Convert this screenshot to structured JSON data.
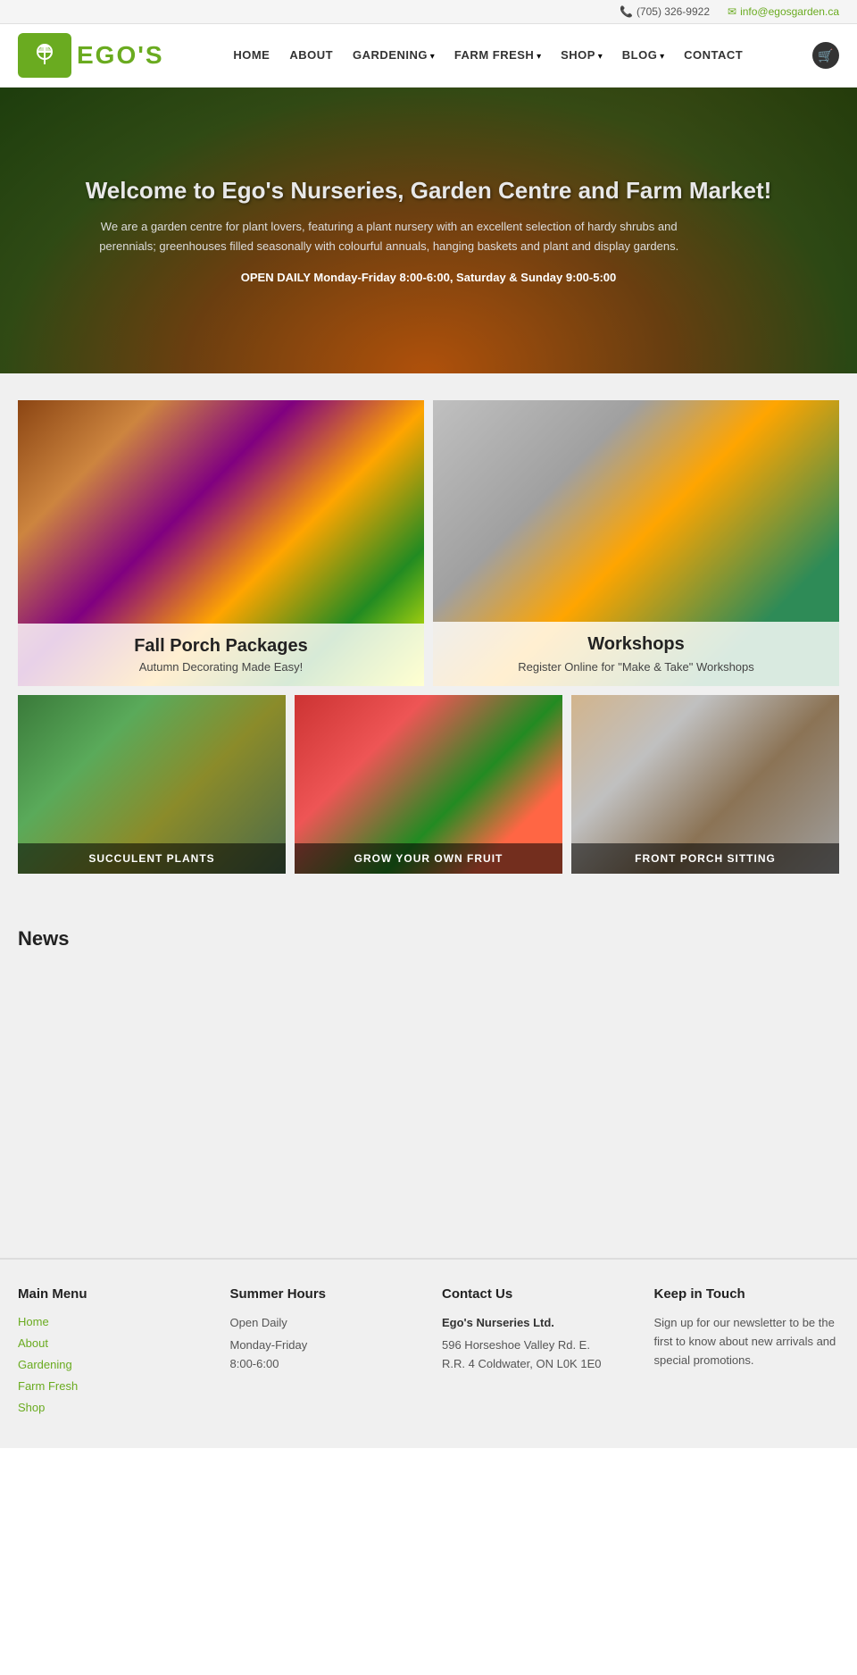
{
  "topbar": {
    "phone": "(705) 326-9922",
    "email": "info@egosgarden.ca",
    "phone_icon": "📞",
    "email_icon": "✉"
  },
  "nav": {
    "logo_text": "EGO'S",
    "links": [
      {
        "label": "HOME",
        "has_dropdown": false
      },
      {
        "label": "ABOUT",
        "has_dropdown": false
      },
      {
        "label": "GARDENING",
        "has_dropdown": true
      },
      {
        "label": "FARM FRESH",
        "has_dropdown": true
      },
      {
        "label": "SHOP",
        "has_dropdown": true
      },
      {
        "label": "BLOG",
        "has_dropdown": true
      },
      {
        "label": "CONTACT",
        "has_dropdown": false
      }
    ]
  },
  "hero": {
    "title": "Welcome to Ego's Nurseries, Garden Centre and Farm Market!",
    "description": "We are a garden centre for plant lovers, featuring a plant nursery with an excellent selection of hardy shrubs and perennials; greenhouses filled seasonally with colourful annuals, hanging baskets and plant and display gardens.",
    "hours": "OPEN DAILY  Monday-Friday 8:00-6:00,  Saturday & Sunday 9:00-5:00"
  },
  "featured": {
    "cards_top": [
      {
        "title": "Fall Porch Packages",
        "subtitle": "Autumn Decorating Made Easy!"
      },
      {
        "title": "Workshops",
        "subtitle": "Register Online for \"Make & Take\" Workshops"
      }
    ],
    "cards_bottom": [
      {
        "label": "SUCCULENT PLANTS"
      },
      {
        "label": "GROW YOUR OWN FRUIT"
      },
      {
        "label": "FRONT PORCH SITTING"
      }
    ]
  },
  "news": {
    "heading": "News"
  },
  "footer": {
    "main_menu": {
      "heading": "Main Menu",
      "links": [
        {
          "label": "Home"
        },
        {
          "label": "About"
        },
        {
          "label": "Gardening"
        },
        {
          "label": "Farm Fresh"
        },
        {
          "label": "Shop"
        }
      ]
    },
    "summer_hours": {
      "heading": "Summer Hours",
      "open_label": "Open Daily",
      "days": "Monday-Friday",
      "times": "8:00-6:00"
    },
    "contact": {
      "heading": "Contact Us",
      "business_name": "Ego's Nurseries Ltd.",
      "address1": "596 Horseshoe Valley Rd. E.",
      "address2": "R.R. 4 Coldwater, ON L0K 1E0"
    },
    "keep_in_touch": {
      "heading": "Keep in Touch",
      "text": "Sign up for our newsletter to be the first to know about new arrivals and special promotions."
    }
  }
}
